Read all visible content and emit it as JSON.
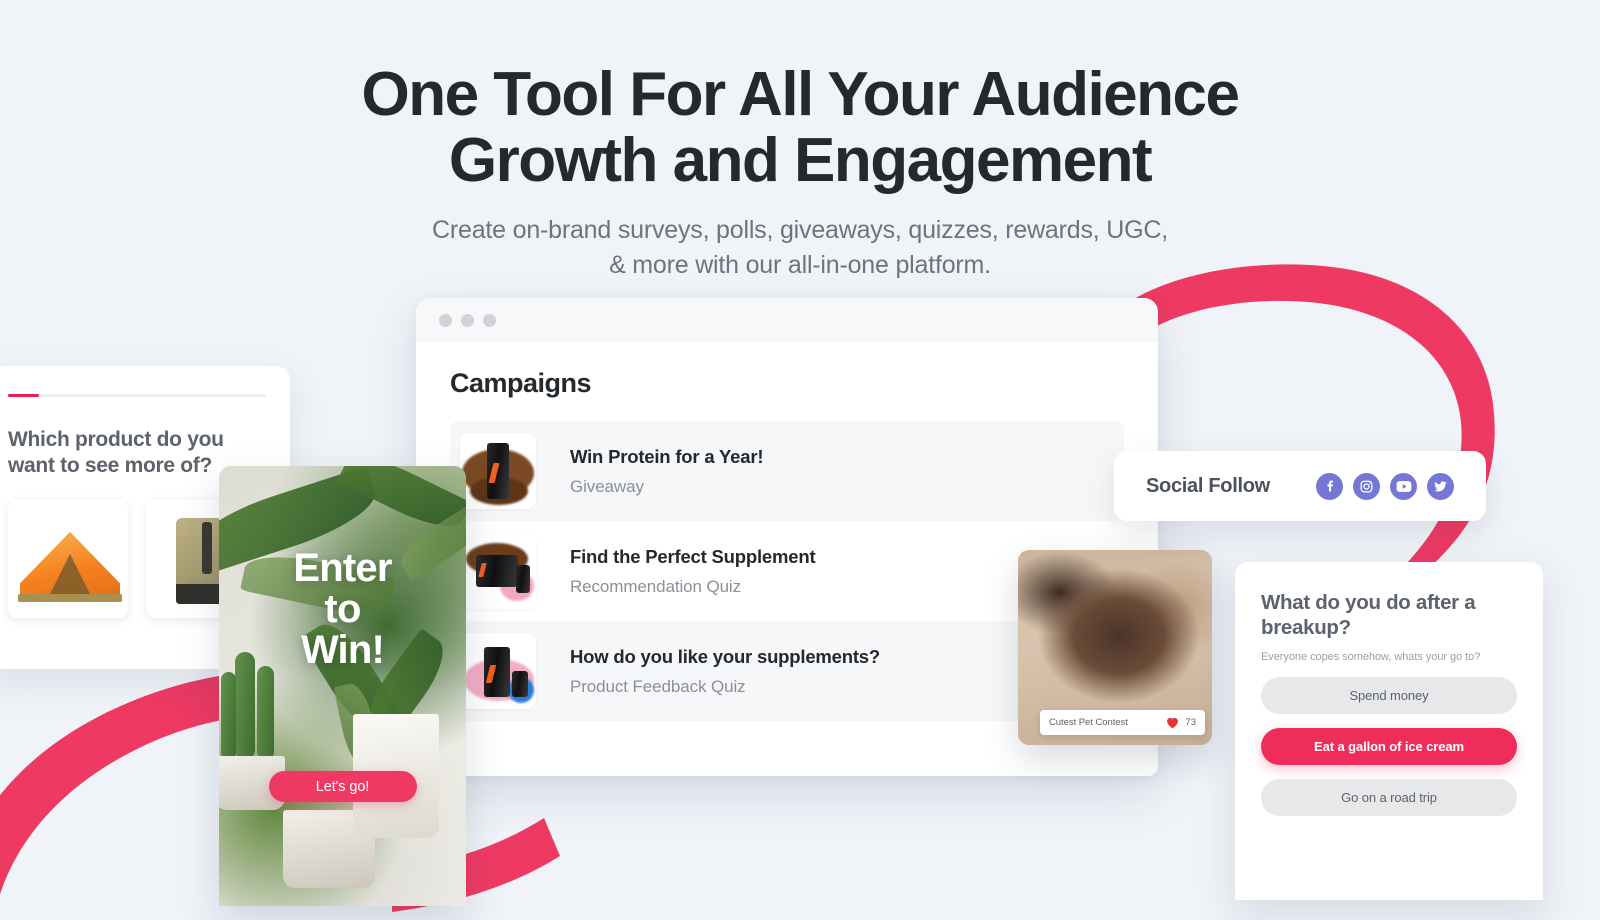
{
  "hero": {
    "headline_line1": "One Tool For All Your Audience",
    "headline_line2": "Growth and Engagement",
    "subhead_line1": "Create on-brand surveys, polls, giveaways, quizzes, rewards, UGC,",
    "subhead_line2": "& more with our all-in-one platform."
  },
  "colors": {
    "background": "#f0f3f8",
    "brand_pink": "#ee3a63",
    "accent_crimson": "#ee2d5b",
    "social_purple": "#7577d6",
    "heading_dark": "#24292e",
    "body_grey": "#6e747d"
  },
  "browser": {
    "panel_title": "Campaigns",
    "traffic_lights": [
      "window-dot-1",
      "window-dot-2",
      "window-dot-3"
    ],
    "campaigns": [
      {
        "name": "Win Protein for a Year!",
        "type": "Giveaway",
        "thumb": "protein-tub-chocolate-splash-thumbnail"
      },
      {
        "name": "Find the Perfect Supplement",
        "type": "Recommendation Quiz",
        "thumb": "ammo-supplement-pack-thumbnail"
      },
      {
        "name": "How do you like your supplements?",
        "type": "Product Feedback Quiz",
        "thumb": "protein-tubs-berry-splash-thumbnail"
      }
    ]
  },
  "product_poll": {
    "progress_percent": 12,
    "question": "Which product do you want to see more of?",
    "options": [
      {
        "label": "orange-dome-tent-image"
      },
      {
        "label": "olive-rolltop-backpack-image"
      }
    ]
  },
  "giveaway_card": {
    "title_line1": "Enter",
    "title_line2": "to",
    "title_line3": "Win!",
    "cta_label": "Let's go!",
    "background": "potted-plants-photo"
  },
  "pet_contest": {
    "caption": "Cutest Pet Contest",
    "like_count": "73",
    "heart_icon": "heart-icon",
    "background": "sleeping-french-bulldog-photo"
  },
  "social_follow": {
    "title": "Social Follow",
    "icons": [
      {
        "name": "facebook-icon",
        "glyph": "f"
      },
      {
        "name": "instagram-icon",
        "glyph": "◎"
      },
      {
        "name": "youtube-icon",
        "glyph": "▶"
      },
      {
        "name": "twitter-icon",
        "glyph": "🐦"
      }
    ]
  },
  "breakup_quiz": {
    "title": "What do you do after a breakup?",
    "subtitle": "Everyone copes somehow, whats your go to?",
    "options": [
      {
        "label": "Spend money",
        "selected": false
      },
      {
        "label": "Eat a gallon of ice cream",
        "selected": true
      },
      {
        "label": "Go on a road trip",
        "selected": false
      }
    ]
  }
}
